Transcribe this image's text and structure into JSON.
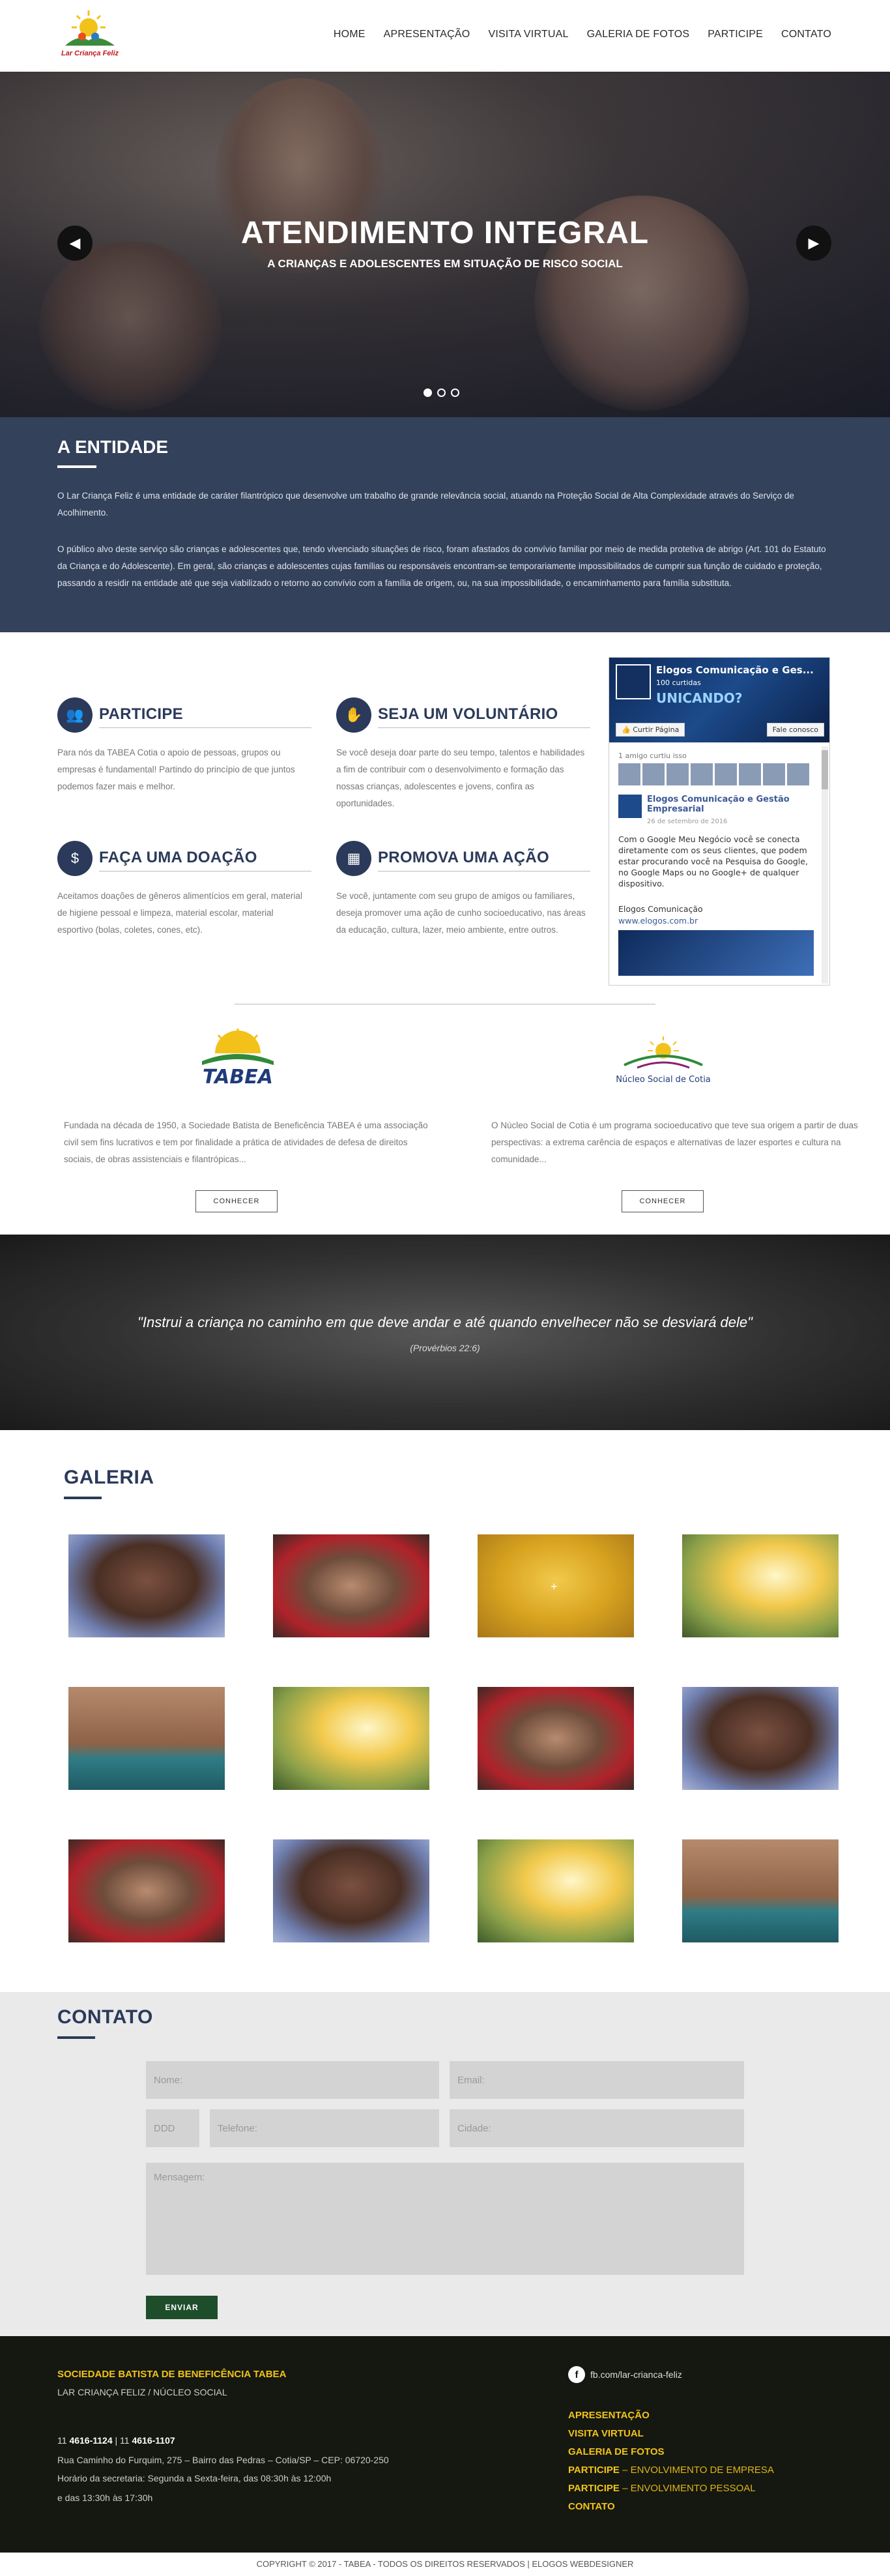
{
  "header": {
    "logo_text": "Lar Criança Feliz",
    "nav": [
      "HOME",
      "APRESENTAÇÃO",
      "VISITA VIRTUAL",
      "GALERIA DE FOTOS",
      "PARTICIPE",
      "CONTATO"
    ]
  },
  "hero": {
    "title": "ATENDIMENTO INTEGRAL",
    "subtitle": "A CRIANÇAS E ADOLESCENTES EM SITUAÇÃO DE RISCO SOCIAL",
    "prev_icon": "chevron-left-icon",
    "next_icon": "chevron-right-icon",
    "slide_count": 3,
    "active_slide": 1
  },
  "entidade": {
    "title": "A ENTIDADE",
    "p1": "O Lar Criança Feliz é uma entidade de caráter filantrópico que desenvolve um trabalho de grande relevância social, atuando na Proteção Social de Alta Complexidade através do Serviço de Acolhimento.",
    "p2": "O público alvo deste serviço são crianças e adolescentes que, tendo vivenciado situações de risco, foram afastados do convívio familiar por meio de medida protetiva de abrigo (Art. 101 do Estatuto da Criança e do Adolescente). Em geral, são crianças e adolescentes cujas famílias ou responsáveis encontram-se temporariamente impossibilitados de cumprir sua função de cuidado e proteção, passando a residir na entidade até que seja viabilizado o retorno ao convívio com a família de origem, ou, na sua impossibilidade, o encaminhamento para família substituta."
  },
  "actions": [
    {
      "title": "PARTICIPE",
      "icon": "people-icon",
      "text": "Para nós da TABEA Cotia o apoio de pessoas, grupos ou empresas é fundamental! Partindo do princípio de que juntos podemos fazer mais e melhor."
    },
    {
      "title": "SEJA UM VOLUNTÁRIO",
      "icon": "hands-icon",
      "text": "Se você deseja doar parte do seu tempo, talentos e habilidades a fim de contribuir com o desenvolvimento e formação das nossas crianças, adolescentes e jovens, confira as oportunidades."
    },
    {
      "title": "FAÇA UMA DOAÇÃO",
      "icon": "dollar-icon",
      "text": "Aceitamos doações de gêneros alimentícios em geral, material de higiene pessoal e limpeza, material escolar, material esportivo (bolas, coletes, cones, etc)."
    },
    {
      "title": "PROMOVA UMA AÇÃO",
      "icon": "calendar-icon",
      "text": "Se você, juntamente com seu grupo de amigos ou familiares, deseja promover uma ação de cunho socioeducativo, nas áreas da educação, cultura, lazer, meio ambiente, entre outros."
    }
  ],
  "facebook": {
    "page_name": "Elogos Comunicação e Ges...",
    "likes": "100 curtidas",
    "banner": "UNICANDO?",
    "like_button": "Curtir Página",
    "contact_button": "Fale conosco",
    "friends_text": "1 amigo curtiu isso",
    "post_author": "Elogos Comunicação e Gestão Empresarial",
    "post_date": "26 de setembro de 2016",
    "post_text": "Com o Google Meu Negócio você se conecta diretamente com os seus clientes, que podem estar procurando você na Pesquisa do Google, no Google Maps ou no Google+ de qualquer dispositivo.",
    "post_sign": "Elogos Comunicação",
    "post_link": "www.elogos.com.br"
  },
  "partners": [
    {
      "logo_text": "TABEA",
      "text": "Fundada na década de 1950, a Sociedade Batista de Beneficência TABEA é uma associação civil sem fins lucrativos e tem por finalidade a prática de atividades de defesa de direitos sociais, de obras assistenciais e filantrópicas...",
      "button": "CONHECER"
    },
    {
      "logo_text": "Núcleo Social de Cotia",
      "text": "O Núcleo Social de Cotia é um programa socioeducativo que teve sua origem a partir de duas perspectivas: a extrema carência de espaços e alternativas de lazer esportes e cultura na comunidade...",
      "button": "CONHECER"
    }
  ],
  "quote": {
    "text": "\"Instrui a criança no caminho em que deve andar e até quando envelhecer não se desviará dele\"",
    "source": "(Provérbios 22:6)"
  },
  "galeria": {
    "title": "GALERIA",
    "images": [
      "girl-portrait",
      "group-kids",
      "kid-yellow",
      "kid-running",
      "boy-smiling",
      "kid-running",
      "group-kids",
      "girl-portrait",
      "group-kids",
      "girl-portrait",
      "kid-running",
      "boy-smiling"
    ]
  },
  "contato": {
    "title": "CONTATO",
    "nome_placeholder": "Nome:",
    "email_placeholder": "Email:",
    "ddd_placeholder": "DDD",
    "telefone_placeholder": "Telefone:",
    "cidade_placeholder": "Cidade:",
    "mensagem_placeholder": "Mensagem:",
    "submit": "ENVIAR"
  },
  "footer": {
    "org": "SOCIEDADE BATISTA DE BENEFICÊNCIA TABEA",
    "sub": "LAR CRIANÇA FELIZ  /  NÚCLEO SOCIAL",
    "phone_prefix1": "11",
    "phone1": "4616-1124",
    "phone_prefix2": "11",
    "phone2": "4616-1107",
    "address": "Rua Caminho do Furquim, 275 – Bairro das Pedras – Cotia/SP – CEP: 06720-250",
    "hours1": "Horário da secretaria: Segunda a Sexta-feira, das 08:30h às 12:00h",
    "hours2": "e das 13:30h às 17:30h",
    "facebook": "fb.com/lar-crianca-feliz",
    "menu": [
      {
        "label": "APRESENTAÇÃO",
        "sub": ""
      },
      {
        "label": "VISITA VIRTUAL",
        "sub": ""
      },
      {
        "label": "GALERIA DE FOTOS",
        "sub": ""
      },
      {
        "label": "PARTICIPE",
        "sub": " – ENVOLVIMENTO DE EMPRESA"
      },
      {
        "label": "PARTICIPE",
        "sub": " – ENVOLVIMENTO PESSOAL"
      },
      {
        "label": "CONTATO",
        "sub": ""
      }
    ],
    "copyright": "COPYRIGHT © 2017 - TABEA - TODOS OS DIREITOS RESERVADOS | ELOGOS WEBDESIGNER"
  }
}
